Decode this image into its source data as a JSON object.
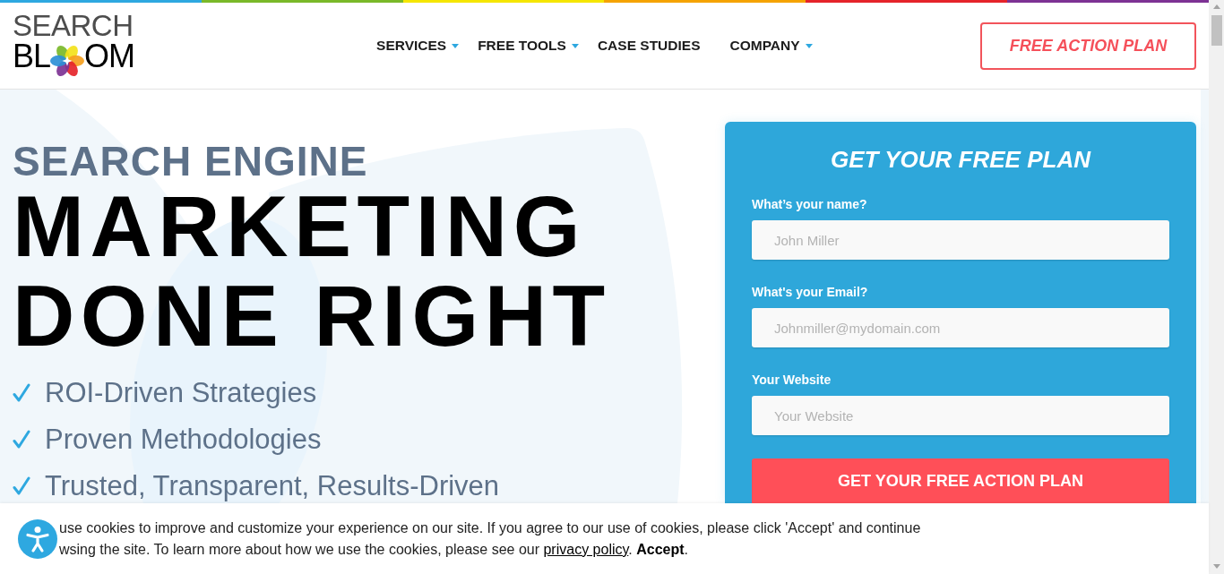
{
  "logo": {
    "top": "SEARCH",
    "bottom_left": "BL",
    "bottom_right": "OM"
  },
  "nav": [
    {
      "label": "SERVICES",
      "has_dropdown": true
    },
    {
      "label": "FREE TOOLS",
      "has_dropdown": true
    },
    {
      "label": "CASE STUDIES",
      "has_dropdown": false
    },
    {
      "label": "COMPANY",
      "has_dropdown": true
    }
  ],
  "header_button": "FREE ACTION PLAN",
  "hero": {
    "eyebrow": "SEARCH ENGINE",
    "headline_lines": [
      "MARKETING",
      "DONE RIGHT"
    ],
    "benefits": [
      "ROI-Driven Strategies",
      "Proven Methodologies",
      "Trusted, Transparent, Results-Driven"
    ]
  },
  "form": {
    "title": "GET YOUR FREE PLAN",
    "fields": [
      {
        "label": "What’s your name?",
        "placeholder": "John Miller"
      },
      {
        "label": "What's your Email?",
        "placeholder": "Johnmiller@mydomain.com"
      },
      {
        "label": "Your Website",
        "placeholder": "Your Website"
      }
    ],
    "submit": "GET YOUR FREE ACTION PLAN"
  },
  "cookie_banner": {
    "lines": [
      "use cookies to improve and customize your experience on our site. If you agree to our use of cookies, please click 'Accept' and continue",
      "wsing the site. To learn more about how we use the cookies, please see our"
    ],
    "link": "privacy policy",
    "link_suffix": ".",
    "accept": "Accept",
    "accept_suffix": "."
  }
}
